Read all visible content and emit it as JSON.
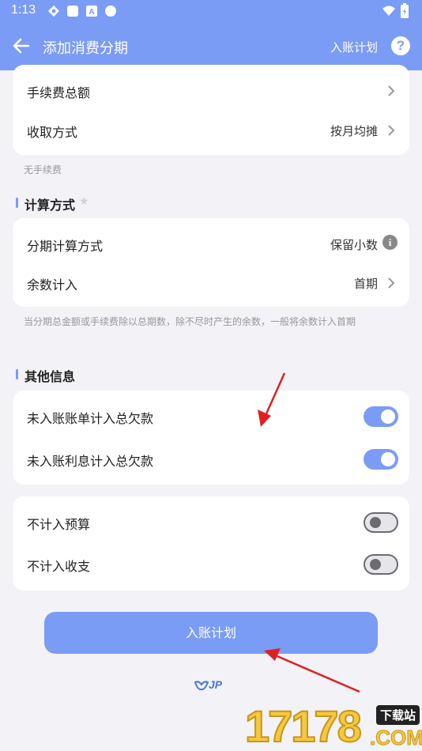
{
  "status_bar": {
    "time": "1:13"
  },
  "topbar": {
    "title": "添加消费分期",
    "action_label": "入账计划",
    "help_label": "?"
  },
  "fee_card": {
    "rows": [
      {
        "label": "手续费总额",
        "value": ""
      },
      {
        "label": "收取方式",
        "value": "按月均摊"
      }
    ],
    "note": "无手续费"
  },
  "calc_section": {
    "title": "计算方式",
    "rows": [
      {
        "label": "分期计算方式",
        "value": "保留小数"
      },
      {
        "label": "余数计入",
        "value": "首期"
      }
    ],
    "note": "当分期总金额或手续费除以总期数，除不尽时产生的余数，一般将余数计入首期"
  },
  "other_section": {
    "title": "其他信息",
    "toggles": [
      {
        "label": "未入账账单计入总欠款",
        "on": true
      },
      {
        "label": "未入账利息计入总欠款",
        "on": true
      }
    ]
  },
  "budget_card": {
    "toggles": [
      {
        "label": "不计入预算",
        "on": false
      },
      {
        "label": "不计入收支",
        "on": false
      }
    ]
  },
  "main_button": {
    "label": "入账计划"
  },
  "logo": {
    "text": "JP"
  },
  "watermark": {
    "number": "17178",
    "download": "下载站",
    "domain": ".COM"
  },
  "colors": {
    "accent": "#7b9cf5",
    "background": "#f2f2f7",
    "arrow": "#e02020"
  }
}
